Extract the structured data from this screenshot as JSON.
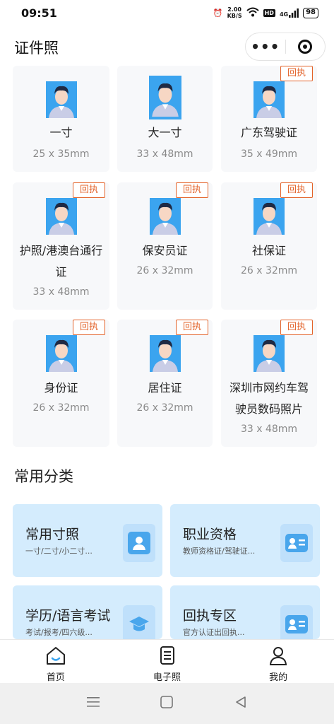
{
  "status": {
    "time": "09:51",
    "speed_top": "2.00",
    "speed_bottom": "KB/S",
    "hd": "HD",
    "network": "4G",
    "battery": "98"
  },
  "header": {
    "title": "证件照",
    "more_glyph": "•••"
  },
  "cards": [
    {
      "name": "一寸",
      "size": "25 x 35mm",
      "badge": ""
    },
    {
      "name": "大一寸",
      "size": "33 x 48mm",
      "badge": ""
    },
    {
      "name": "广东驾驶证",
      "size": "35 x 49mm",
      "badge": "回执"
    },
    {
      "name_line1": "护照/港澳台通行",
      "name_line2": "证",
      "size": "33 x 48mm",
      "badge": "回执"
    },
    {
      "name": "保安员证",
      "size": "26 x 32mm",
      "badge": "回执"
    },
    {
      "name": "社保证",
      "size": "26 x 32mm",
      "badge": "回执"
    },
    {
      "name": "身份证",
      "size": "26 x 32mm",
      "badge": "回执"
    },
    {
      "name": "居住证",
      "size": "26 x 32mm",
      "badge": "回执"
    },
    {
      "name_line1": "深圳市网约车驾",
      "name_line2": "驶员数码照片",
      "size": "33 x 48mm",
      "badge": "回执"
    }
  ],
  "categories_section": {
    "title": "常用分类"
  },
  "categories": [
    {
      "title": "常用寸照",
      "subtitle": "一寸/二寸/小二寸...",
      "icon": "portrait-icon"
    },
    {
      "title": "职业资格",
      "subtitle": "教师资格证/驾驶证...",
      "icon": "id-card-icon"
    },
    {
      "title": "学历/语言考试",
      "subtitle": "考试/报考/四六级...",
      "icon": "graduation-cap-icon"
    },
    {
      "title": "回执专区",
      "subtitle": "官方认证出回执...",
      "icon": "receipt-card-icon"
    }
  ],
  "tabs": [
    {
      "label": "首页",
      "icon": "home-icon"
    },
    {
      "label": "电子照",
      "icon": "document-icon"
    },
    {
      "label": "我的",
      "icon": "user-icon"
    }
  ],
  "colors": {
    "accent": "#e3632a",
    "portrait_bg": "#3ba4ef",
    "category_bg": "#d4ecfd"
  }
}
